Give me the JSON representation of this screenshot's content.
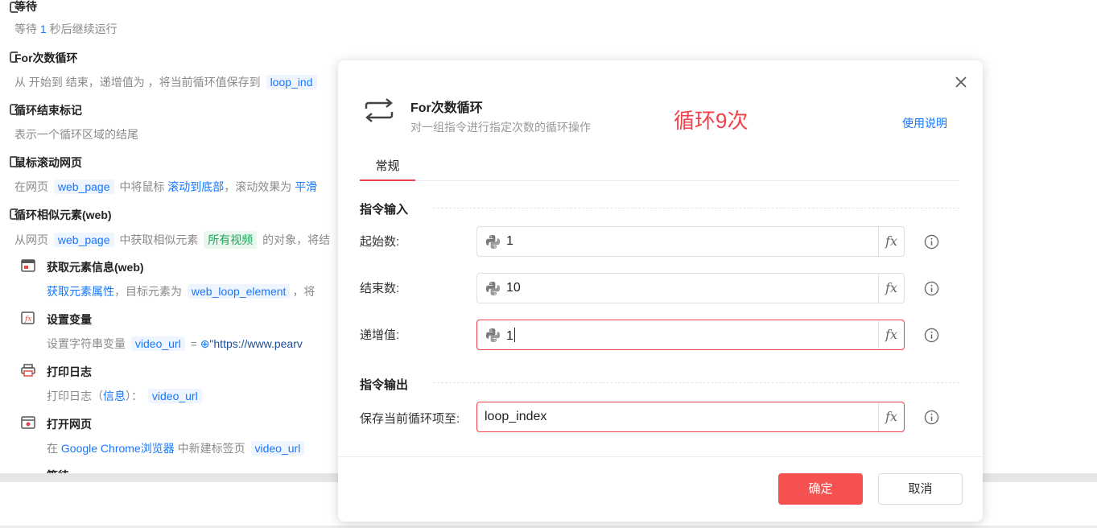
{
  "steps": [
    {
      "title": "等待",
      "desc": {
        "t1": "等待 ",
        "v1": "1",
        "t2": " 秒后继续运行"
      }
    },
    {
      "title": "For次数循环",
      "desc": {
        "t1": "从 开始到 结束，递增值为 ，将当前循环值保存到 ",
        "tag1": "loop_ind"
      }
    },
    {
      "title": "循环结束标记",
      "desc": {
        "t1": "表示一个循环区域的结尾"
      }
    },
    {
      "title": "鼠标滚动网页",
      "desc": {
        "t1": "在网页 ",
        "tag1": "web_page",
        "t2": " 中将鼠标 ",
        "link1": "滚动到底部",
        "t3": "，滚动效果为 ",
        "link2": "平滑"
      }
    },
    {
      "title": "循环相似元素(web)",
      "desc": {
        "t1": "从网页 ",
        "tag1": "web_page",
        "t2": " 中获取相似元素 ",
        "tag2": "所有视频",
        "t3": " 的对象，将结"
      }
    },
    {
      "title": "获取元素信息(web)",
      "desc": {
        "link1": "获取元素属性",
        "t1": "，目标元素为 ",
        "tag1": "web_loop_element",
        "t2": "，将"
      }
    },
    {
      "title": "设置变量",
      "desc": {
        "t1": "设置字符串变量 ",
        "tag1": "video_url",
        "t2": " = ",
        "t3": "\"https://www.pearv"
      }
    },
    {
      "title": "打印日志",
      "desc": {
        "t1": "打印日志（",
        "link1": "信息",
        "t2": "）： ",
        "tag1": "video_url"
      }
    },
    {
      "title": "打开网页",
      "desc": {
        "t1": "在 ",
        "link1": "Google Chrome浏览器",
        "t2": " 中新建标签页 ",
        "tag1": "video_url"
      }
    },
    {
      "title": "等待"
    }
  ],
  "dialog": {
    "title": "For次数循环",
    "subtitle": "对一组指令进行指定次数的循环操作",
    "annotation": "循环9次",
    "help": "使用说明",
    "tab": "常规",
    "input_section": "指令输入",
    "output_section": "指令输出",
    "fields": {
      "start": {
        "label": "起始数:",
        "value": "1"
      },
      "end": {
        "label": "结束数:",
        "value": "10"
      },
      "step": {
        "label": "递增值:",
        "value": "1"
      },
      "save": {
        "label": "保存当前循环项至:",
        "value": "loop_index"
      }
    },
    "fx": "fx",
    "ok": "确定",
    "cancel": "取消"
  },
  "colors": {
    "accent": "#f55150",
    "link": "#1677ff",
    "annotation": "#f0424a"
  },
  "icons": [
    "loop-icon",
    "close-icon",
    "python-icon",
    "info-icon",
    "fx-icon"
  ]
}
